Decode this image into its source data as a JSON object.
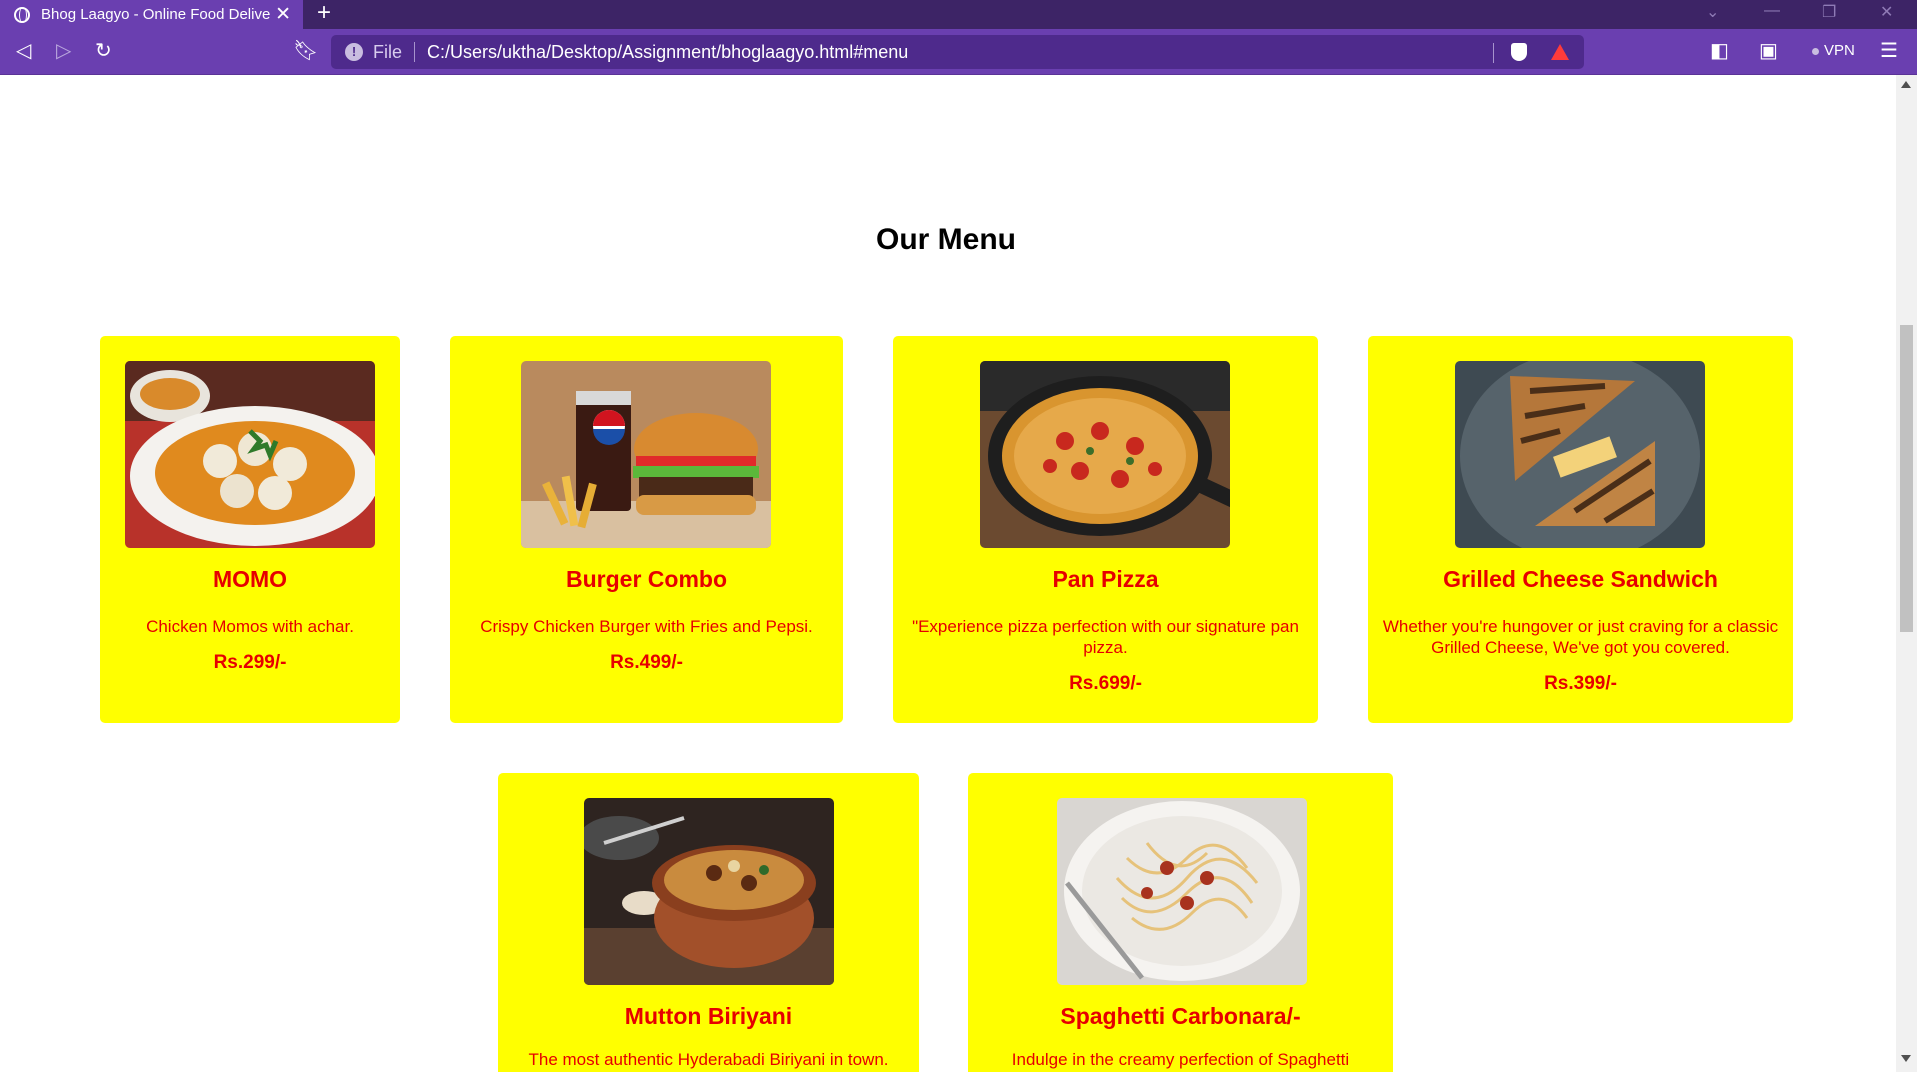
{
  "browser": {
    "tab_title": "Bhog Laagyo - Online Food Delive",
    "tab_close": "✕",
    "new_tab": "+",
    "url_scheme": "File",
    "url": "C:/Users/uktha/Desktop/Assignment/bhoglaagyo.html#menu",
    "vpn_label": "VPN",
    "accent_color": "#6a3fb0"
  },
  "page": {
    "heading": "Our Menu"
  },
  "menu": [
    {
      "name": "MOMO",
      "description": "Chicken Momos with achar.",
      "price": "Rs.299/-",
      "image": "momo-photo"
    },
    {
      "name": "Burger Combo",
      "description": "Crispy Chicken Burger with Fries and Pepsi.",
      "price": "Rs.499/-",
      "image": "burger-combo-photo"
    },
    {
      "name": "Pan Pizza",
      "description": "\"Experience pizza perfection with our signature pan pizza.",
      "price": "Rs.699/-",
      "image": "pan-pizza-photo"
    },
    {
      "name": "Grilled Cheese Sandwich",
      "description": "Whether you're hungover or just craving for a classic Grilled Cheese, We've got you covered.",
      "price": "Rs.399/-",
      "image": "grilled-cheese-photo"
    },
    {
      "name": "Mutton Biriyani",
      "description": "The most authentic Hyderabadi Biriyani in town.",
      "price": "",
      "image": "biriyani-photo"
    },
    {
      "name": "Spaghetti Carbonara/-",
      "description": "Indulge in the creamy perfection of Spaghetti",
      "price": "",
      "image": "spaghetti-photo"
    }
  ],
  "colors": {
    "card_background": "#ffff00",
    "card_text": "#e60000"
  }
}
